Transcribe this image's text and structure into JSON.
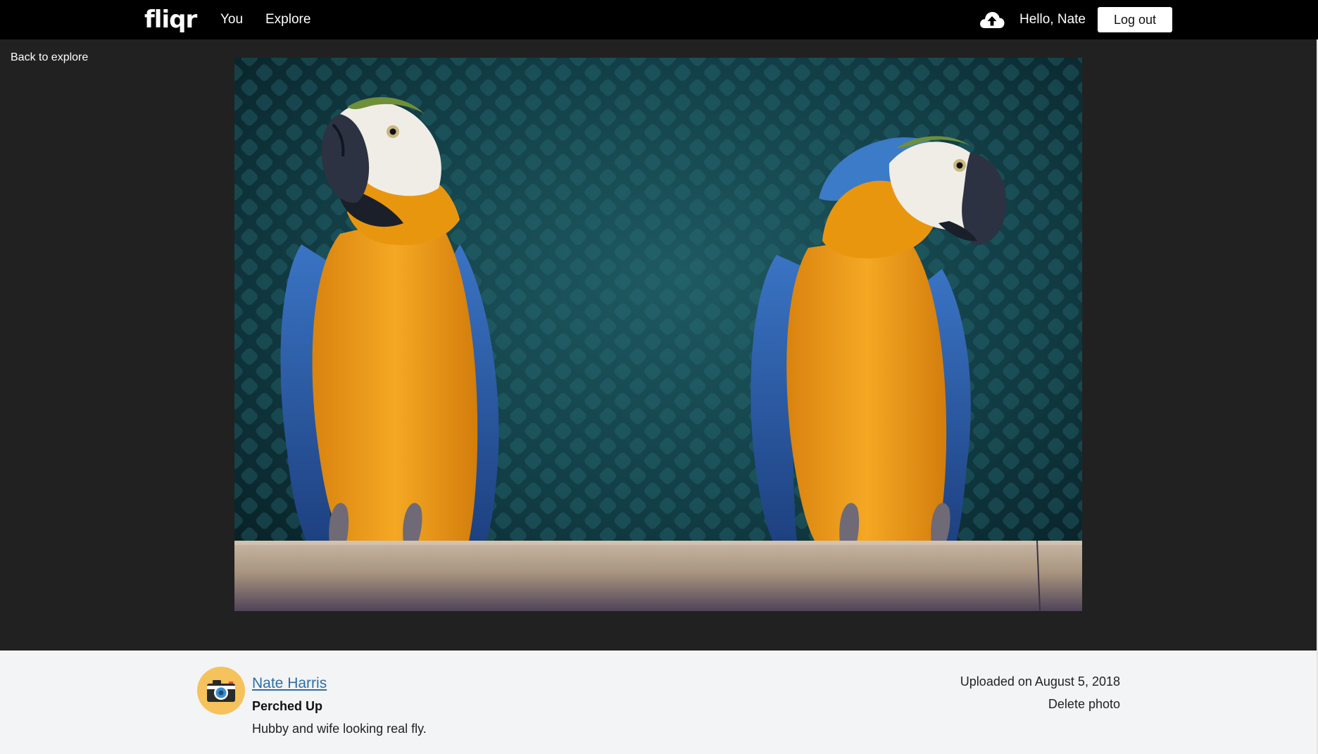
{
  "app": {
    "logo": "fliqr"
  },
  "nav": {
    "you": "You",
    "explore": "Explore",
    "upload_icon": "cloud-upload-icon",
    "greeting": "Hello, Nate",
    "logout": "Log out"
  },
  "stage": {
    "back_link": "Back to explore",
    "photo_alt": "Two blue-and-yellow macaws perched on a branch"
  },
  "info": {
    "avatar_icon": "camera-icon",
    "author": "Nate Harris",
    "title": "Perched Up",
    "description": "Hubby and wife looking real fly.",
    "uploaded": "Uploaded on August 5, 2018",
    "delete": "Delete photo"
  },
  "colors": {
    "navbar_bg": "#000000",
    "stage_bg": "#212121",
    "info_bg": "#f3f4f6",
    "link_blue": "#2e6fa5",
    "avatar_yellow": "#f6c25b"
  }
}
